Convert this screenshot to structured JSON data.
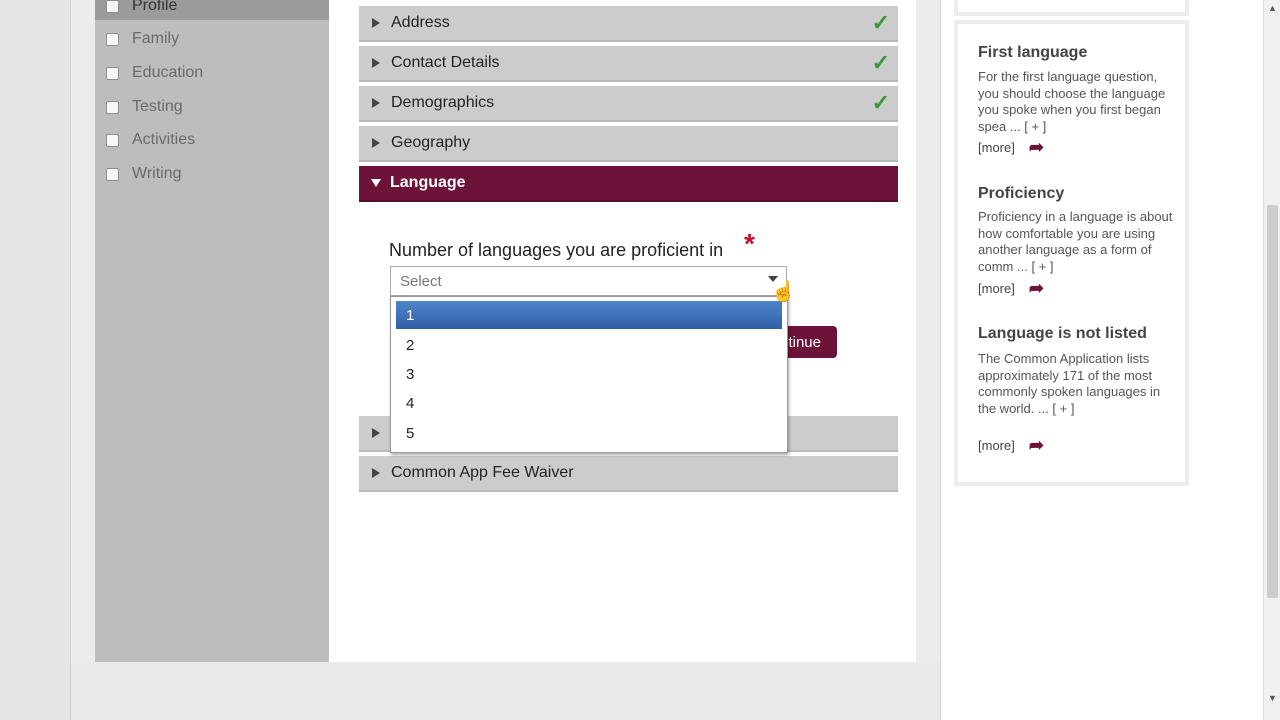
{
  "sidebar": {
    "items": [
      {
        "label": "Profile",
        "active": true
      },
      {
        "label": "Family"
      },
      {
        "label": "Education"
      },
      {
        "label": "Testing"
      },
      {
        "label": "Activities"
      },
      {
        "label": "Writing"
      }
    ]
  },
  "sections": [
    {
      "label": "Address",
      "complete": true
    },
    {
      "label": "Contact Details",
      "complete": true
    },
    {
      "label": "Demographics",
      "complete": true
    },
    {
      "label": "Geography",
      "complete": false
    },
    {
      "label": "Language",
      "open": true
    },
    {
      "label": "Common App Fee Waiver",
      "complete": false
    }
  ],
  "check_glyph": "✓",
  "question": {
    "label": "Number of languages you are proficient in",
    "required_mark": "*",
    "select": {
      "value": "Select",
      "options": [
        "1",
        "2",
        "3",
        "4",
        "5"
      ],
      "highlighted": "1"
    },
    "continue_label": "tinue"
  },
  "help": [
    {
      "title": "First language",
      "body": "For the first language question, you should choose the language you spoke when you first began spea ... [ + ]",
      "more": "[more]"
    },
    {
      "title": "Proficiency",
      "body": "Proficiency in a language is about how comfortable you are using another language as a form of comm ... [ + ]",
      "more": "[more]"
    },
    {
      "title": "Language is not listed",
      "body": "The Common Application lists approximately 171 of the most commonly spoken languages in the world. ... [ + ]",
      "more": "[more]"
    }
  ],
  "colors": {
    "accent": "#6d1238",
    "complete_check": "#3a9a3a",
    "required": "#c8102e",
    "option_highlight": "#3a6db5"
  }
}
